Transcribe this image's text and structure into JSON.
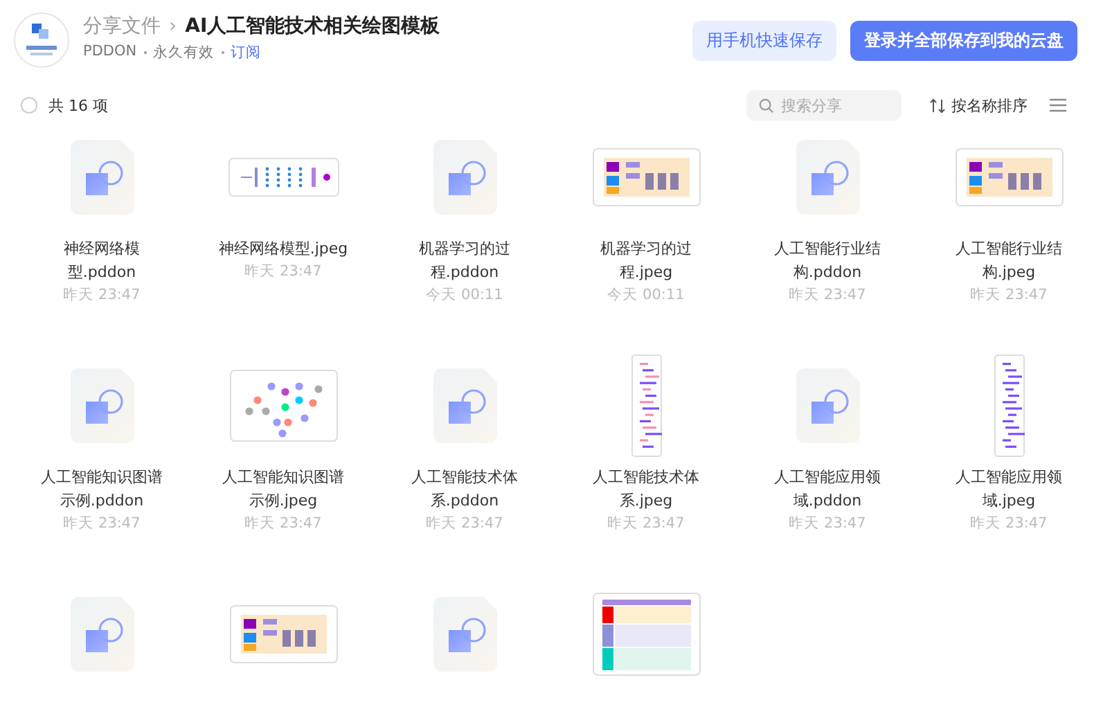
{
  "header": {
    "breadcrumb": "分享文件",
    "separator": "›",
    "title": "AI人工智能技术相关绘图模板",
    "owner": "PDDON",
    "validity": "永久有效",
    "subscribe": "订阅",
    "buttons": [
      {
        "label": "用手机快速保存",
        "kind": "secondary"
      },
      {
        "label": "登录并全部保存到我的云盘",
        "kind": "primary"
      }
    ]
  },
  "toolbar": {
    "select_all": {
      "checked": false
    },
    "count": "共 16 项",
    "search": {
      "placeholder": "搜索分享"
    },
    "sort": "按名称排序"
  },
  "files": [
    {
      "name": "神经网络模型.pddon",
      "date": "昨天 23:47",
      "kind": "doc"
    },
    {
      "name": "神经网络模型.jpeg",
      "date": "昨天 23:47",
      "kind": "strip"
    },
    {
      "name": "机器学习的过程.pddon",
      "date": "今天 00:11",
      "kind": "doc"
    },
    {
      "name": "机器学习的过程.jpeg",
      "date": "今天 00:11",
      "kind": "wide"
    },
    {
      "name": "人工智能行业结构.pddon",
      "date": "昨天 23:47",
      "kind": "doc"
    },
    {
      "name": "人工智能行业结构.jpeg",
      "date": "昨天 23:47",
      "kind": "wide"
    },
    {
      "name": "人工智能知识图谱示例.pddon",
      "date": "昨天 23:47",
      "kind": "doc"
    },
    {
      "name": "人工智能知识图谱示例.jpeg",
      "date": "昨天 23:47",
      "kind": "graph"
    },
    {
      "name": "人工智能技术体系.pddon",
      "date": "昨天 23:47",
      "kind": "doc"
    },
    {
      "name": "人工智能技术体系.jpeg",
      "date": "昨天 23:47",
      "kind": "tall"
    },
    {
      "name": "人工智能应用领域.pddon",
      "date": "昨天 23:47",
      "kind": "doc"
    },
    {
      "name": "人工智能应用领域.jpeg",
      "date": "昨天 23:47",
      "kind": "tall"
    },
    {
      "kind": "doc"
    },
    {
      "kind": "wide"
    },
    {
      "kind": "doc"
    },
    {
      "kind": "table"
    }
  ]
}
